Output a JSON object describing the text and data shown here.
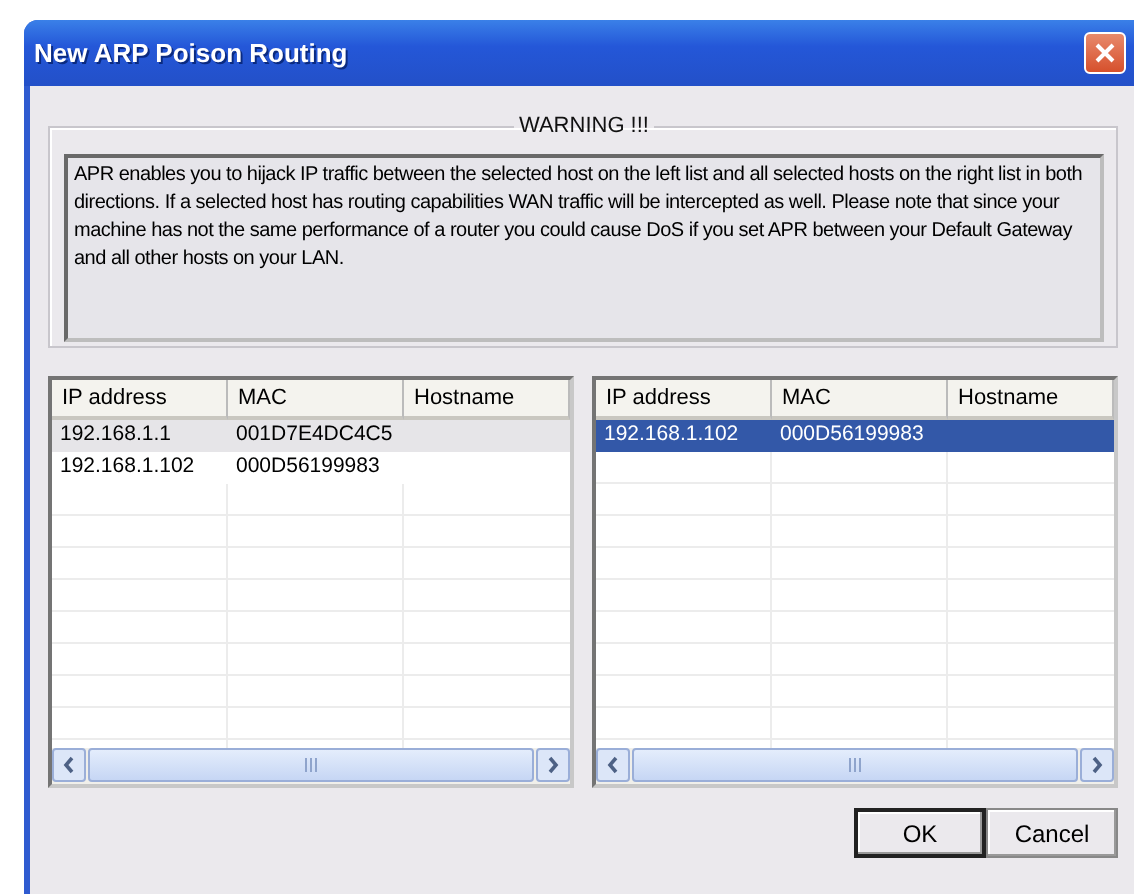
{
  "window": {
    "title": "New ARP Poison Routing"
  },
  "warning": {
    "title": "WARNING !!!",
    "text": "APR enables you to hijack IP traffic between the selected host on the left list and all selected hosts on the right list in both directions. If a selected host has routing capabilities WAN traffic will be intercepted as well. Please note that since your machine has not the same performance of a router you could cause DoS if you set APR between your Default Gateway and all other hosts on your LAN."
  },
  "lists": [
    {
      "focused": false,
      "columns": [
        "IP address",
        "MAC",
        "Hostname"
      ],
      "rows": [
        {
          "cells": [
            "192.168.1.1",
            "001D7E4DC4C5"
          ],
          "selected": true
        },
        {
          "cells": [
            "192.168.1.102",
            "000D56199983"
          ],
          "selected": false
        }
      ]
    },
    {
      "focused": true,
      "columns": [
        "IP address",
        "MAC",
        "Hostname"
      ],
      "rows": [
        {
          "cells": [
            "192.168.1.102",
            "000D56199983"
          ],
          "selected": true
        }
      ]
    }
  ],
  "buttons": [
    {
      "label": "OK",
      "default": true
    },
    {
      "label": "Cancel",
      "default": false
    }
  ]
}
